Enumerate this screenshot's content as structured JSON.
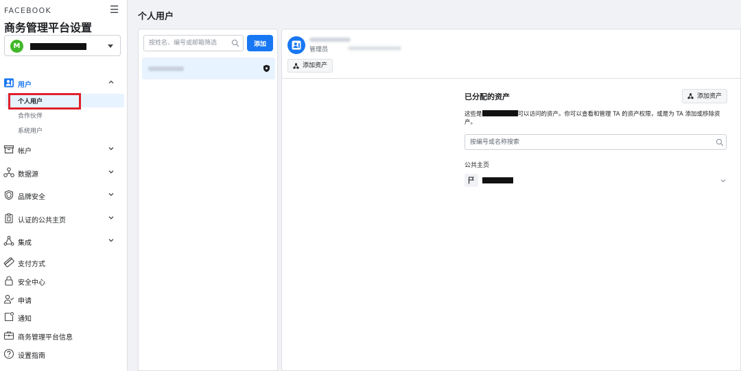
{
  "sidebar": {
    "brand": "FACEBOOK",
    "heading": "商务管理平台设置",
    "account_avatar_letter": "M",
    "sections": {
      "users": "用户",
      "accounts": "帐户",
      "data_sources": "数据源",
      "brand_safety": "品牌安全",
      "verified_pages": "认证的公共主页",
      "integrations": "集成",
      "payment": "支付方式",
      "security": "安全中心",
      "requests": "申请",
      "notifications": "通知",
      "business_info": "商务管理平台信息",
      "setup_guide": "设置指南"
    },
    "user_sub_items": {
      "people": "个人用户",
      "partners": "合作伙伴",
      "system_users": "系统用户"
    }
  },
  "header": {
    "title": "个人用户"
  },
  "user_list": {
    "search_placeholder": "按姓名、编号或邮箱筛选",
    "add_label": "添加"
  },
  "detail": {
    "role": "管理员",
    "add_assets_label": "添加资产",
    "assigned_title": "已分配的资产",
    "desc_prefix": "这些是",
    "desc_suffix": "可以访问的资产。你可以查看和管理 TA 的资产权限，或是为 TA 添加或移除资产。",
    "asset_search_placeholder": "按编号或名称搜索",
    "section_pages": "公共主页"
  },
  "colors": {
    "accent": "#1877f2",
    "highlight": "#e0202a",
    "avatar_green": "#42b72a"
  }
}
